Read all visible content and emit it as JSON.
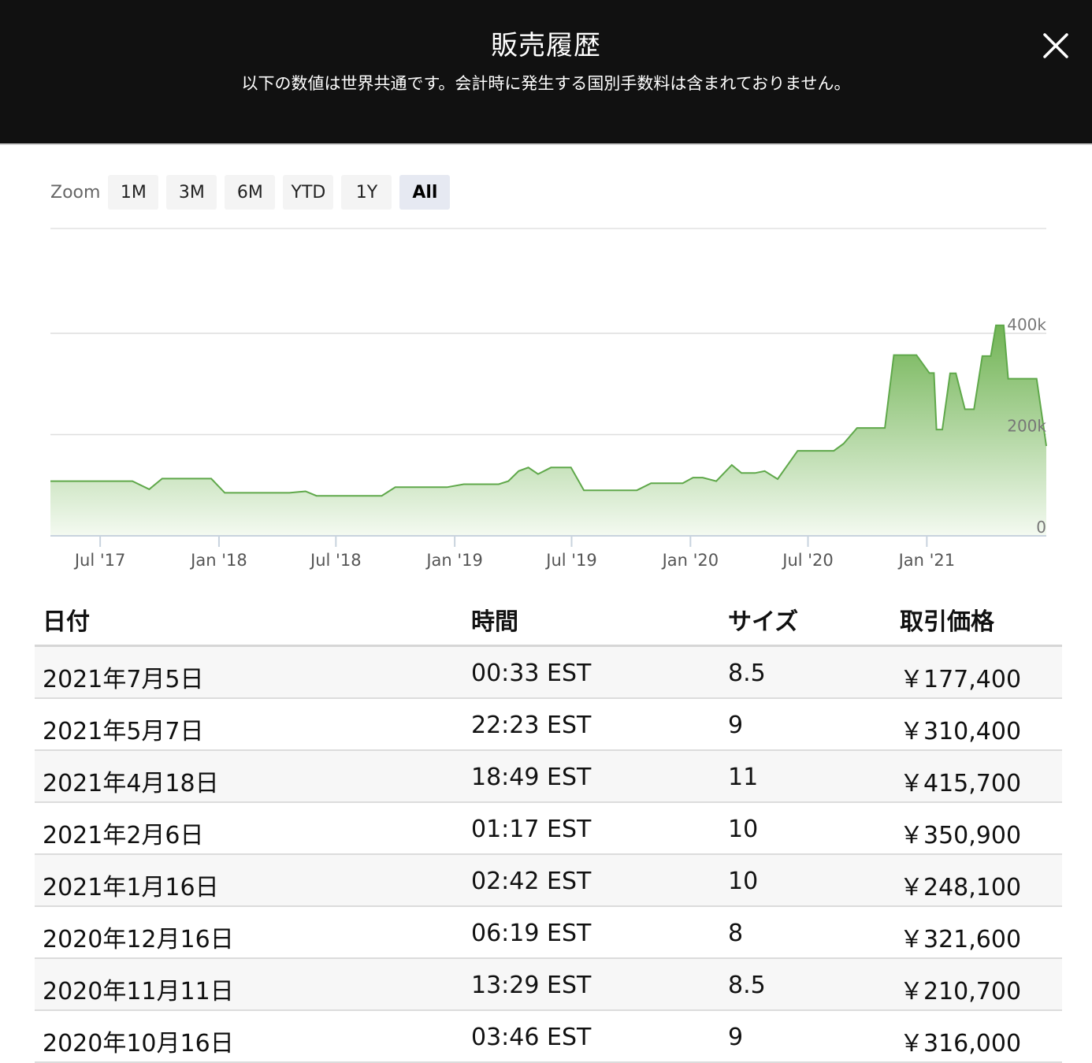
{
  "header": {
    "title": "販売履歴",
    "subtitle": "以下の数値は世界共通です。会計時に発生する国別手数料は含まれておりません。",
    "close_icon": "close-icon"
  },
  "zoom": {
    "label": "Zoom",
    "options": [
      "1M",
      "3M",
      "6M",
      "YTD",
      "1Y",
      "All"
    ],
    "active": "All"
  },
  "colors": {
    "line": "#5fa84a",
    "fill_top": "#6ab04c",
    "fill_bottom": "#f4faf1",
    "header_bg": "#111111"
  },
  "chart_data": {
    "type": "area",
    "title": "",
    "xlabel": "",
    "ylabel": "",
    "x_ticks": [
      "Jul '17",
      "Jan '18",
      "Jul '18",
      "Jan '19",
      "Jul '19",
      "Jan '20",
      "Jul '20",
      "Jan '21"
    ],
    "y_ticks": [
      "0",
      "200k",
      "400k"
    ],
    "ylim": [
      0,
      410000
    ],
    "xlim": [
      "2017-04-15",
      "2021-07-05"
    ],
    "grid": true,
    "series": [
      {
        "points": [
          [
            "2017-04-15",
            108000
          ],
          [
            "2017-08-20",
            108000
          ],
          [
            "2017-09-15",
            92000
          ],
          [
            "2017-10-05",
            113000
          ],
          [
            "2017-12-20",
            113000
          ],
          [
            "2018-01-10",
            85000
          ],
          [
            "2018-04-20",
            85000
          ],
          [
            "2018-05-15",
            88000
          ],
          [
            "2018-06-01",
            79000
          ],
          [
            "2018-09-10",
            79000
          ],
          [
            "2018-10-01",
            96000
          ],
          [
            "2018-12-20",
            96000
          ],
          [
            "2019-01-15",
            102000
          ],
          [
            "2019-03-10",
            102000
          ],
          [
            "2019-03-25",
            108000
          ],
          [
            "2019-04-10",
            128000
          ],
          [
            "2019-04-25",
            135000
          ],
          [
            "2019-05-10",
            122000
          ],
          [
            "2019-05-30",
            135000
          ],
          [
            "2019-06-30",
            135000
          ],
          [
            "2019-07-20",
            90000
          ],
          [
            "2019-10-10",
            90000
          ],
          [
            "2019-11-01",
            104000
          ],
          [
            "2019-12-20",
            104000
          ],
          [
            "2020-01-05",
            115000
          ],
          [
            "2020-01-20",
            115000
          ],
          [
            "2020-02-10",
            108000
          ],
          [
            "2020-03-05",
            140000
          ],
          [
            "2020-03-20",
            124000
          ],
          [
            "2020-04-10",
            124000
          ],
          [
            "2020-04-25",
            128000
          ],
          [
            "2020-05-15",
            112000
          ],
          [
            "2020-06-15",
            168000
          ],
          [
            "2020-08-10",
            168000
          ],
          [
            "2020-08-25",
            182000
          ],
          [
            "2020-09-15",
            213000
          ],
          [
            "2020-10-15",
            213000
          ],
          [
            "2020-10-28",
            213000
          ],
          [
            "2020-11-11",
            357000
          ],
          [
            "2020-12-16",
            357000
          ],
          [
            "2021-01-05",
            321600
          ],
          [
            "2021-01-12",
            321600
          ],
          [
            "2021-01-16",
            210000
          ],
          [
            "2021-01-25",
            210000
          ],
          [
            "2021-02-06",
            321000
          ],
          [
            "2021-02-15",
            321000
          ],
          [
            "2021-03-01",
            250000
          ],
          [
            "2021-03-15",
            250000
          ],
          [
            "2021-03-28",
            355000
          ],
          [
            "2021-04-10",
            355000
          ],
          [
            "2021-04-18",
            415700
          ],
          [
            "2021-04-30",
            415700
          ],
          [
            "2021-05-07",
            310400
          ],
          [
            "2021-06-20",
            310400
          ],
          [
            "2021-07-05",
            177400
          ]
        ]
      }
    ]
  },
  "table": {
    "headers": [
      "日付",
      "時間",
      "サイズ",
      "取引価格"
    ],
    "rows": [
      [
        "2021年7月5日",
        "00:33 EST",
        "8.5",
        "￥177,400"
      ],
      [
        "2021年5月7日",
        "22:23 EST",
        "9",
        "￥310,400"
      ],
      [
        "2021年4月18日",
        "18:49 EST",
        "11",
        "￥415,700"
      ],
      [
        "2021年2月6日",
        "01:17 EST",
        "10",
        "￥350,900"
      ],
      [
        "2021年1月16日",
        "02:42 EST",
        "10",
        "￥248,100"
      ],
      [
        "2020年12月16日",
        "06:19 EST",
        "8",
        "￥321,600"
      ],
      [
        "2020年11月11日",
        "13:29 EST",
        "8.5",
        "￥210,700"
      ],
      [
        "2020年10月16日",
        "03:46 EST",
        "9",
        "￥316,000"
      ]
    ]
  }
}
